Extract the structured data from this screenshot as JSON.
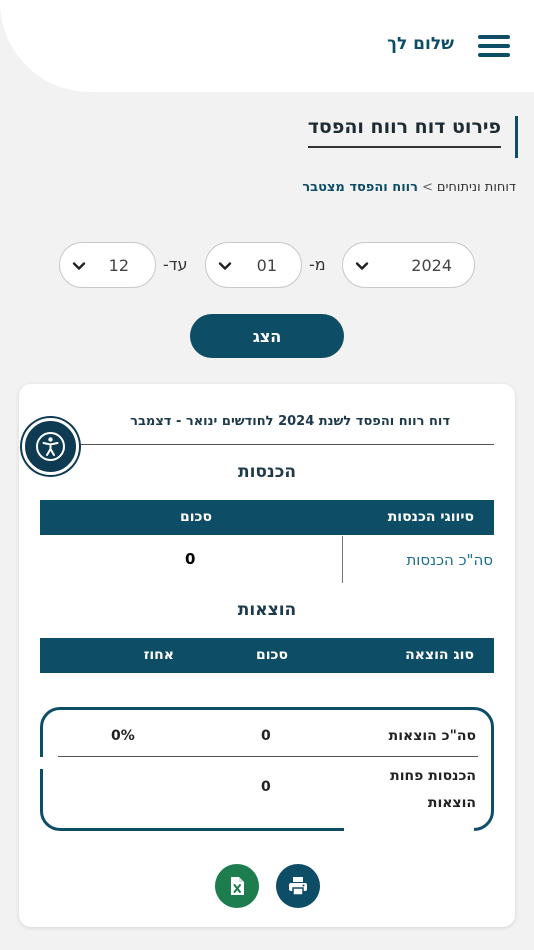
{
  "header": {
    "greeting": "שלום לך"
  },
  "page": {
    "title": "פירוט דוח רווח והפסד"
  },
  "breadcrumb": {
    "parent": "דוחות וניתוחים",
    "separator": ">",
    "current": "רווח והפסד מצטבר"
  },
  "filters": {
    "year": "2024",
    "from_label": "מ-",
    "from_month": "01",
    "to_label": "עד-",
    "to_month": "12",
    "show_button": "הצג"
  },
  "report": {
    "title": "דוח רווח והפסד לשנת 2024 לחודשים ינואר - דצמבר",
    "income": {
      "section_title": "הכנסות",
      "columns": [
        "סיווגי הכנסות",
        "סכום"
      ],
      "total_label": "סה\"כ הכנסות",
      "total_value": "0"
    },
    "expenses": {
      "section_title": "הוצאות",
      "columns": [
        "סוג הוצאה",
        "סכום",
        "אחוז"
      ]
    },
    "summary": {
      "expenses_total_label": "סה\"כ הוצאות",
      "expenses_total_value": "0",
      "expenses_total_percent": "0%",
      "net_label_line1": "הכנסות פחות",
      "net_label_line2": "הוצאות",
      "net_value": "0"
    }
  },
  "colors": {
    "primary": "#0e4d66",
    "excel": "#1e7d4e",
    "link": "#1a6c8b"
  },
  "icons": {
    "menu": "hamburger-icon",
    "accessibility": "accessibility-icon",
    "excel": "excel-icon",
    "print": "printer-icon",
    "dropdown": "chevron-down-icon"
  }
}
